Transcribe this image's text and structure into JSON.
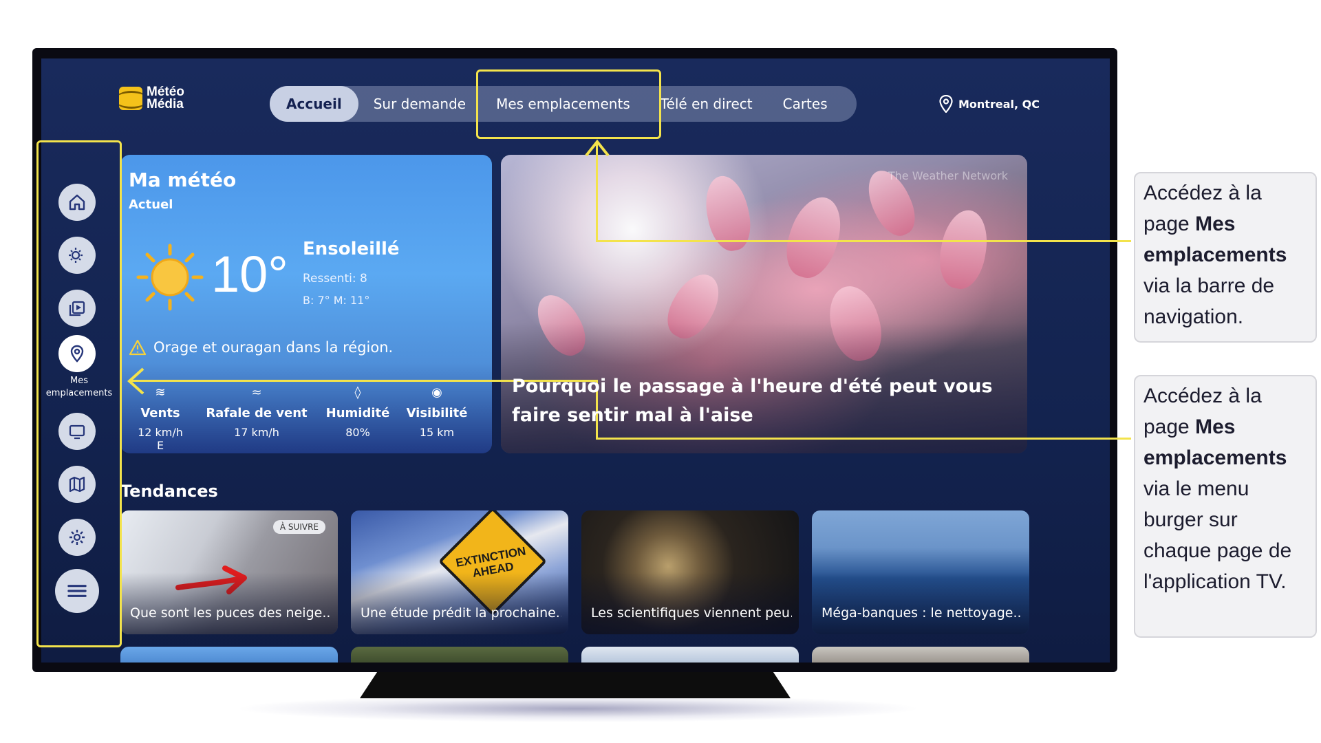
{
  "logo": {
    "line1": "Météo",
    "line2": "Média"
  },
  "nav": {
    "tabs": [
      {
        "label": "Accueil",
        "active": true
      },
      {
        "label": "Sur demande",
        "active": false
      },
      {
        "label": "Mes emplacements",
        "active": false
      },
      {
        "label": "Télé en direct",
        "active": false
      },
      {
        "label": "Cartes",
        "active": false
      }
    ],
    "location": "Montreal, QC"
  },
  "sidebar": {
    "items": [
      {
        "icon": "home-icon"
      },
      {
        "icon": "weather-sun-icon"
      },
      {
        "icon": "video-library-icon"
      },
      {
        "icon": "location-pin-icon",
        "label": "Mes emplacements",
        "selected": true
      },
      {
        "icon": "tv-icon"
      },
      {
        "icon": "map-icon"
      },
      {
        "icon": "gear-icon"
      },
      {
        "icon": "burger-menu-icon"
      }
    ]
  },
  "weather": {
    "title": "Ma météo",
    "subtitle": "Actuel",
    "temperature": "10°",
    "condition": "Ensoleillé",
    "feels_like": "Ressenti:  8",
    "hi_lo": "B:  7°  M:  11°",
    "alert": "Orage et ouragan dans la région.",
    "stats": [
      {
        "label": "Vents",
        "value": "12 km/h E",
        "icon": "wind-icon"
      },
      {
        "label": "Rafale de vent",
        "value": "17 km/h",
        "icon": "gust-icon"
      },
      {
        "label": "Humidité",
        "value": "80%",
        "icon": "drop-icon"
      },
      {
        "label": "Visibilité",
        "value": "15 km",
        "icon": "eye-icon"
      }
    ]
  },
  "hero": {
    "title": "Pourquoi le passage à l'heure d'été peut vous faire sentir mal à l'aise",
    "watermark": "The Weather Network"
  },
  "trends": {
    "heading": "Tendances",
    "cards": [
      {
        "caption": "Que sont les puces des neige...",
        "badge": "À SUIVRE"
      },
      {
        "caption": "Une étude prédit la prochaine...",
        "sign_text": "EXTINCTION AHEAD"
      },
      {
        "caption": "Les scientifiques viennent peu..."
      },
      {
        "caption": "Méga-banques : le nettoyage..."
      }
    ]
  },
  "annotations": {
    "callout1": {
      "a": "Accédez à la page ",
      "b": "Mes emplacements",
      "c": " via la barre de navigation."
    },
    "callout2": {
      "a": "Accédez à la page ",
      "b": "Mes emplacements",
      "c": " via le menu burger sur chaque page de l'application TV."
    },
    "highlight_color": "#f3e34c"
  }
}
